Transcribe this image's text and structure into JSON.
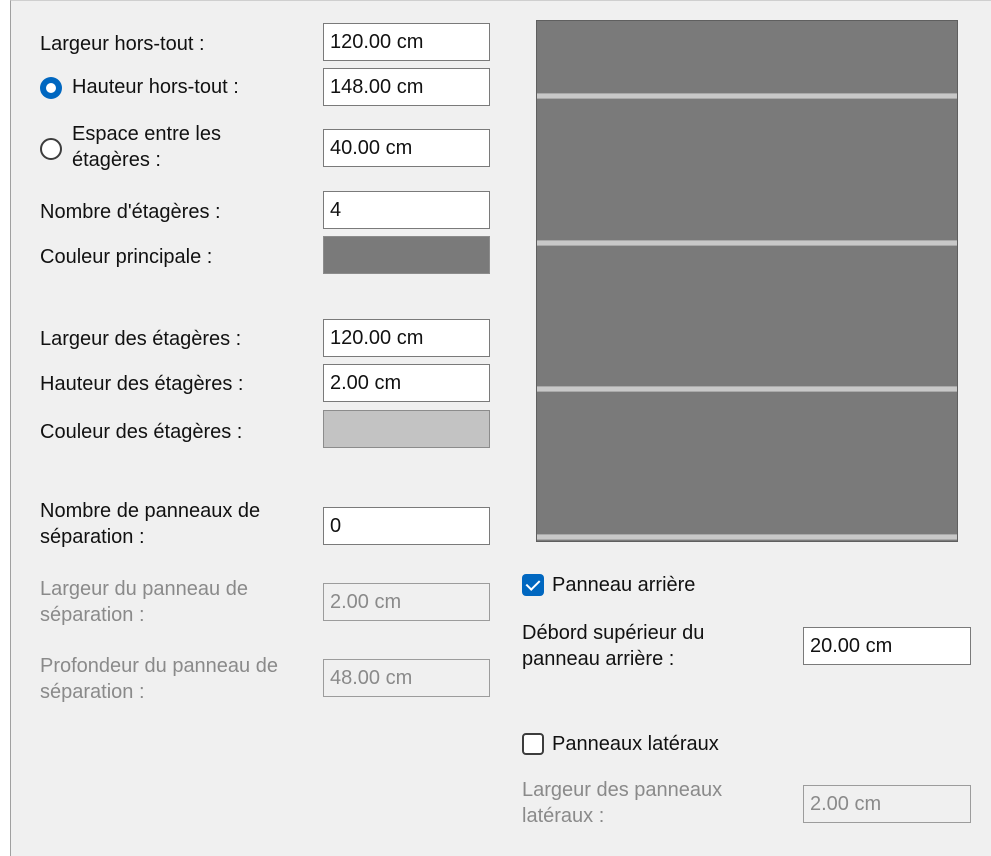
{
  "fields": {
    "overall_width": {
      "label": "Largeur hors-tout :",
      "value": "120.00 cm"
    },
    "overall_height": {
      "label": "Hauteur hors-tout :",
      "value": "148.00 cm",
      "selected": true
    },
    "shelf_spacing": {
      "label": "Espace entre les étagères :",
      "value": "40.00 cm",
      "selected": false
    },
    "shelf_count": {
      "label": "Nombre d'étagères :",
      "value": "4"
    },
    "main_color": {
      "label": "Couleur principale :",
      "color": "#7a7a7a"
    },
    "shelf_width": {
      "label": "Largeur des étagères :",
      "value": "120.00 cm"
    },
    "shelf_height": {
      "label": "Hauteur des étagères :",
      "value": "2.00 cm"
    },
    "shelf_color": {
      "label": "Couleur des étagères :",
      "color": "#c3c3c3"
    },
    "divider_count": {
      "label": "Nombre de panneaux de séparation :",
      "value": "0"
    },
    "divider_width": {
      "label": "Largeur du panneau de séparation :",
      "value": "2.00 cm",
      "disabled": true
    },
    "divider_depth": {
      "label": "Profondeur du panneau de séparation :",
      "value": "48.00 cm",
      "disabled": true
    }
  },
  "back_panel": {
    "label": "Panneau arrière",
    "checked": true
  },
  "back_overhang": {
    "label": "Débord supérieur du panneau arrière :",
    "value": "20.00 cm"
  },
  "side_panels": {
    "label": "Panneaux latéraux",
    "checked": false
  },
  "side_width": {
    "label": "Largeur des panneaux latéraux :",
    "value": "2.00 cm",
    "disabled": true
  },
  "colors": {
    "accent": "#0067c0",
    "panel_bg": "#f0f0f0",
    "preview_body": "#7a7a7a",
    "preview_shelf": "#c8c8c8"
  }
}
